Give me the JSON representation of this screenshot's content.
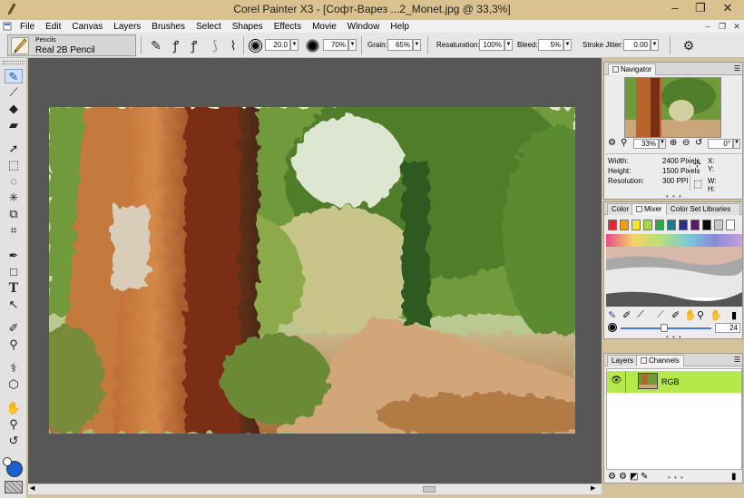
{
  "window": {
    "title": "Corel Painter X3 - [Софт-Варез ...2_Monet.jpg @ 33,3%]",
    "app_icon": "brush-icon",
    "minimize": "–",
    "restore": "❐",
    "close": "✕"
  },
  "menu": [
    "File",
    "Edit",
    "Canvas",
    "Layers",
    "Brushes",
    "Select",
    "Shapes",
    "Effects",
    "Movie",
    "Window",
    "Help"
  ],
  "brush": {
    "category": "Pencils",
    "variant": "Real 2B Pencil"
  },
  "property_bar": {
    "size": "20.0",
    "opacity": "70%",
    "grain_label": "Grain:",
    "grain": "65%",
    "resaturation_label": "Resaturation:",
    "resaturation": "100%",
    "bleed_label": "Bleed:",
    "bleed": "5%",
    "stroke_jitter_label": "Stroke Jitter:",
    "stroke_jitter": "0.00"
  },
  "navigator": {
    "tab": "Navigator",
    "zoom": "33%",
    "rotation": "0°",
    "width_label": "Width:",
    "width": "2400 Pixels",
    "height_label": "Height:",
    "height": "1500 Pixels",
    "resolution_label": "Resolution:",
    "resolution": "300 PPI",
    "x_label": "X:",
    "y_label": "Y:",
    "w_label": "W:",
    "h_label": "H:"
  },
  "color_panel": {
    "tabs": [
      "Color",
      "Mixer",
      "Color Set Libraries"
    ],
    "swatches": [
      "#e0262b",
      "#f39c12",
      "#f4e82b",
      "#a8d83d",
      "#2faa4a",
      "#1d7d8a",
      "#2c2e8a",
      "#5b1a6b",
      "#0b0b0b",
      "#c7c7c7",
      "#ffffff"
    ],
    "brush_size": "24"
  },
  "layers": {
    "tabs": [
      "Layers",
      "Channels"
    ],
    "channel": "RGB"
  },
  "colors": {
    "title_bar": "#d9c28f",
    "workspace": "#575757",
    "rgb_row": "#b5e84a",
    "current_color": "#1c5fd0"
  }
}
